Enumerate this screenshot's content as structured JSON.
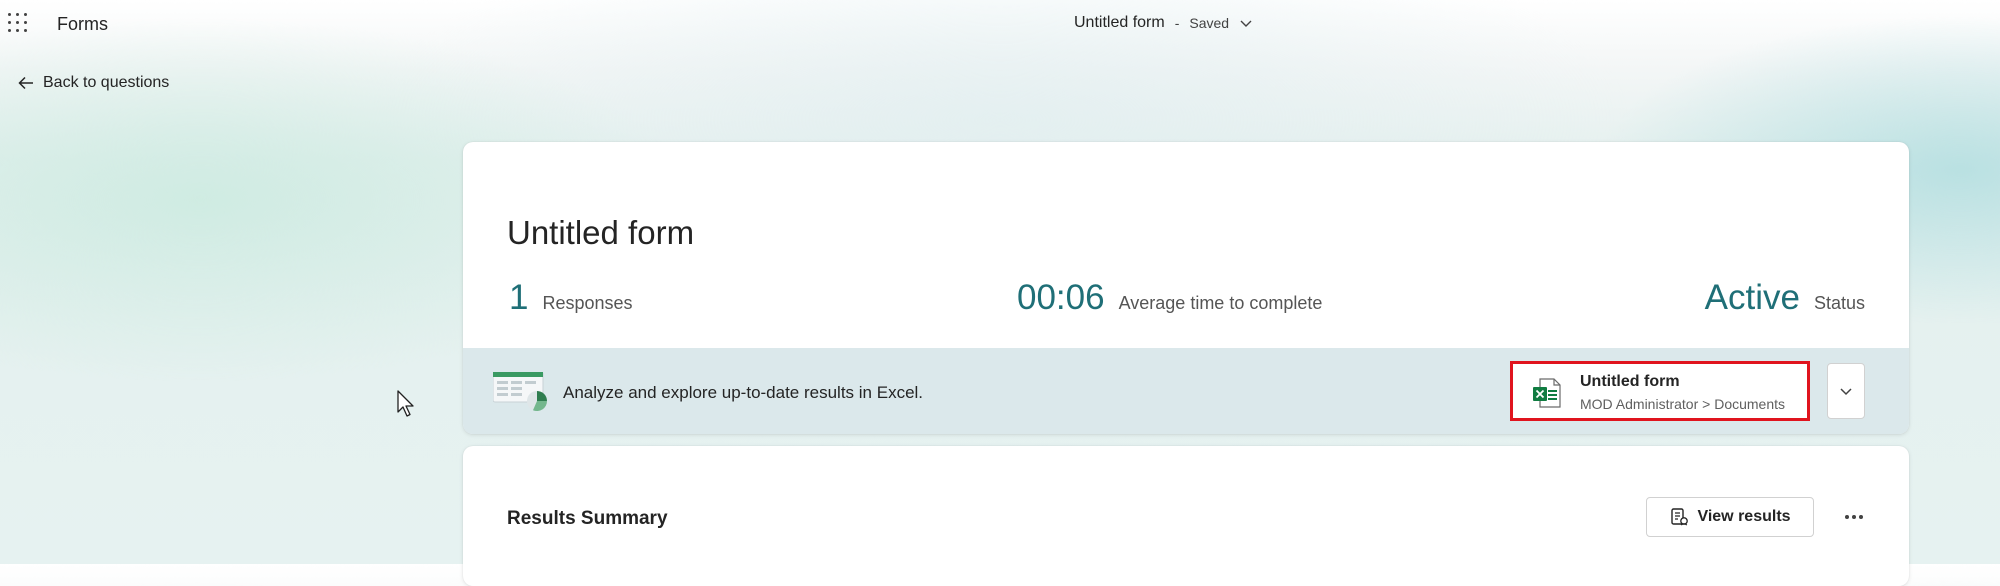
{
  "header": {
    "app_name": "Forms",
    "doc_title": "Untitled form",
    "separator": "-",
    "save_status": "Saved",
    "icons": {
      "launcher": "app-launcher-icon",
      "expand": "chevron-down-icon"
    }
  },
  "nav": {
    "back_label": "Back to questions",
    "back_icon": "arrow-left-icon"
  },
  "summary": {
    "form_title": "Untitled form",
    "stats": [
      {
        "value": "1",
        "label": "Responses"
      },
      {
        "value": "00:06",
        "label": "Average time to complete"
      },
      {
        "value": "Active",
        "label": "Status"
      }
    ]
  },
  "excel": {
    "message": "Analyze and explore up-to-date results in Excel.",
    "file_name": "Untitled form",
    "file_path": "MOD Administrator > Documents",
    "icons": {
      "illustration": "excel-analysis-illustration",
      "file": "excel-file-icon",
      "menu": "chevron-down-icon"
    }
  },
  "results": {
    "title": "Results Summary",
    "view_label": "View results",
    "icons": {
      "view": "view-results-icon",
      "more": "more-options-icon"
    }
  },
  "colors": {
    "accent_teal": "#1f6f77",
    "highlight_red": "#e0141e",
    "excel_green": "#107c41",
    "strip_bg": "#dbe8eb"
  }
}
